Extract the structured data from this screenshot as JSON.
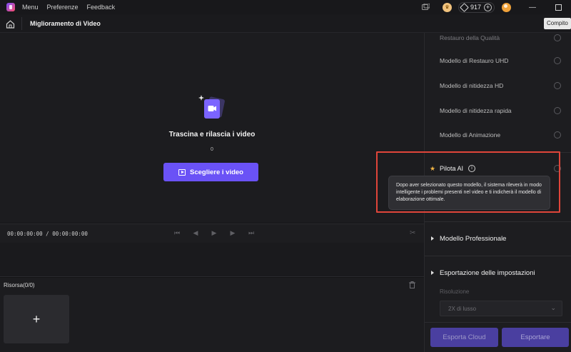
{
  "titlebar": {
    "menu": [
      "Menu",
      "Preferenze",
      "Feedback"
    ],
    "credits": "917"
  },
  "header": {
    "page_title": "Miglioramento di Video",
    "tooltip": "Compito"
  },
  "preview": {
    "drop_title": "Trascina e rilascia i video",
    "file_count": "0",
    "choose_button": "Scegliere i video"
  },
  "player": {
    "timecode": "00:00:00:00 / 00:00:00:00"
  },
  "resources": {
    "title": "Risorsa(0/0)",
    "add_label": "+"
  },
  "models": {
    "header_faded": "Restauro della Qualità",
    "items": [
      "Modello di Restauro UHD",
      "Modello di nitidezza HD",
      "Modello di nitidezza rapida",
      "Modello di Animazione"
    ],
    "pilot_label": "Pilota AI",
    "pilot_tooltip": "Dopo aver selezionato questo modello, il sistema rileverà in modo intelligente i problemi presenti nel video e ti indicherà il modello di elaborazione ottimale."
  },
  "sections": {
    "professional": "Modello Professionale",
    "export_settings": "Esportazione delle impostazioni"
  },
  "export": {
    "resolution_label": "Risoluzione",
    "resolution_value": "2X di lusso",
    "cloud_button": "Esporta Cloud",
    "export_button": "Esportare"
  },
  "colors": {
    "accent": "#6a52f6",
    "highlight": "#e0453a",
    "star": "#f1b545"
  }
}
